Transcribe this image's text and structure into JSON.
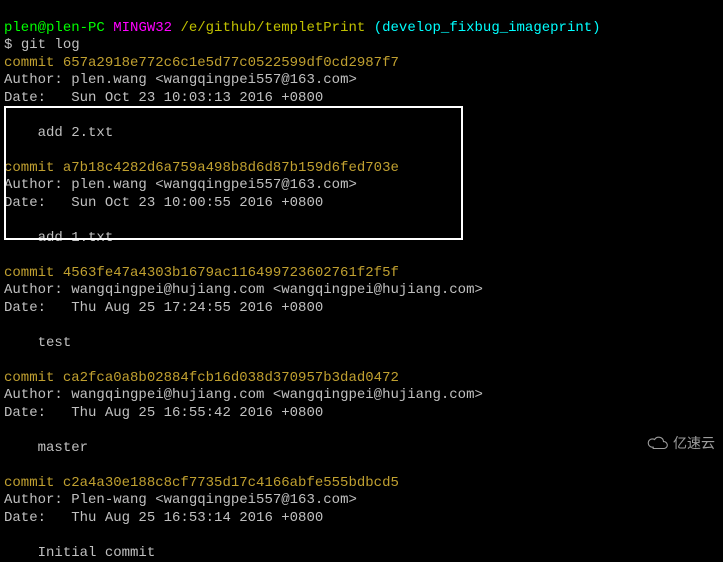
{
  "prompt": {
    "user": "plen",
    "host": "plen-PC",
    "shell": "MINGW32",
    "path": "/e/github/templetPrint",
    "branch": "develop_fixbug_imageprint",
    "sigil": "$ ",
    "command": "git log"
  },
  "commits": [
    {
      "hash": "657a2918e772c6c1e5d77c0522599df0cd2987f7",
      "author": "plen.wang <wangqingpei557@163.com>",
      "date": "Sun Oct 23 10:03:13 2016 +0800",
      "message": "add 2.txt"
    },
    {
      "hash": "a7b18c4282d6a759a498b8d6d87b159d6fed703e",
      "author": "plen.wang <wangqingpei557@163.com>",
      "date": "Sun Oct 23 10:00:55 2016 +0800",
      "message": "add 1.txt"
    },
    {
      "hash": "4563fe47a4303b1679ac116499723602761f2f5f",
      "author": "wangqingpei@hujiang.com <wangqingpei@hujiang.com>",
      "date": "Thu Aug 25 17:24:55 2016 +0800",
      "message": "test"
    },
    {
      "hash": "ca2fca0a8b02884fcb16d038d370957b3dad0472",
      "author": "wangqingpei@hujiang.com <wangqingpei@hujiang.com>",
      "date": "Thu Aug 25 16:55:42 2016 +0800",
      "message": "master"
    },
    {
      "hash": "c2a4a30e188c8cf7735d17c4166abfe555bdbcd5",
      "author": "Plen-wang <wangqingpei557@163.com>",
      "date": "Thu Aug 25 16:53:14 2016 +0800",
      "message": "Initial commit"
    }
  ],
  "labels": {
    "commit": "commit ",
    "author": "Author: ",
    "date": "Date:   ",
    "at": "@",
    "space": " ",
    "lparen": "(",
    "rparen": ")"
  },
  "watermark": "亿速云"
}
